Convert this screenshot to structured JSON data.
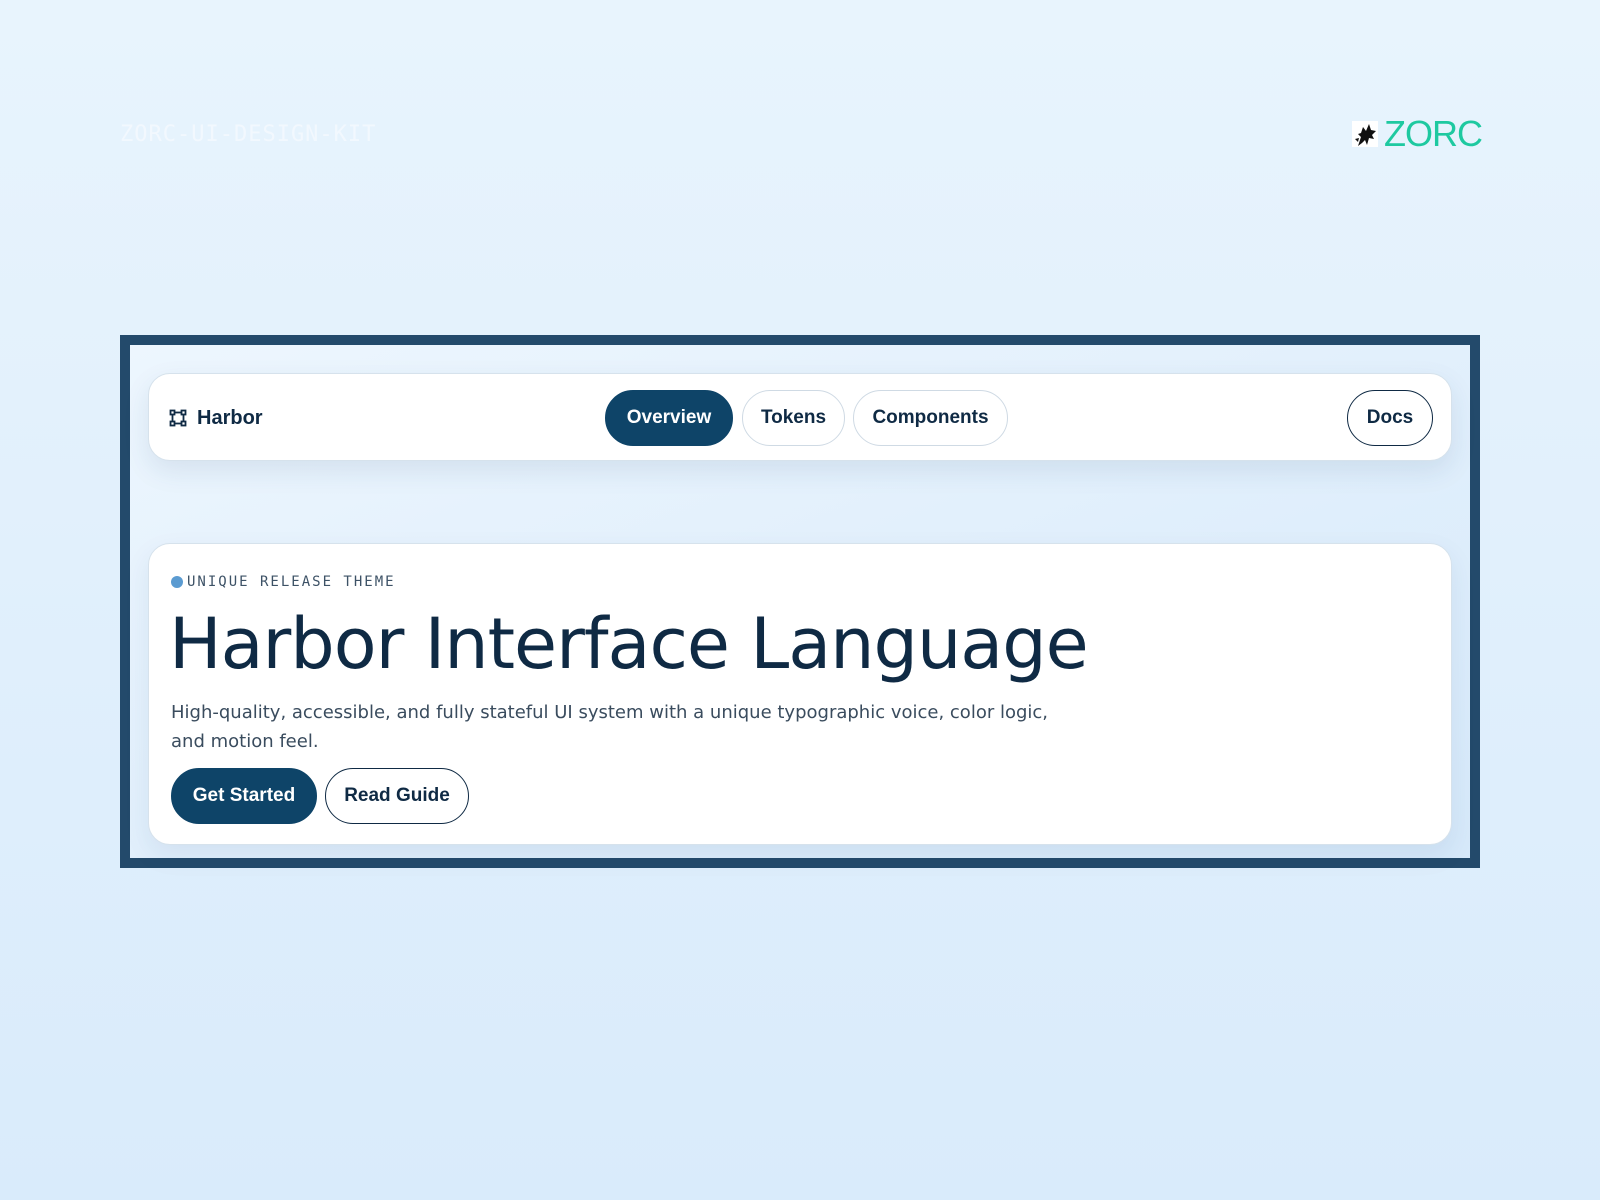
{
  "kit_label": "ZORC-UI-DESIGN-KIT",
  "brand": {
    "word": "ZORC",
    "mark_icon": "wolf-logo-icon",
    "color": "#1ec9a0"
  },
  "navbar": {
    "brand_label": "Harbor",
    "brand_icon": "vector-nodes-icon",
    "tabs": [
      {
        "label": "Overview",
        "active": true
      },
      {
        "label": "Tokens",
        "active": false
      },
      {
        "label": "Components",
        "active": false
      }
    ],
    "docs_label": "Docs"
  },
  "hero": {
    "eyebrow": "UNIQUE RELEASE THEME",
    "title": "Harbor Interface Language",
    "description": "High-quality, accessible, and fully stateful UI system with a unique typographic voice, color logic, and motion feel.",
    "primary_cta": "Get Started",
    "secondary_cta": "Read Guide"
  },
  "colors": {
    "primary": "#0e4468",
    "text": "#0f2a44",
    "frame_border": "#234a6b",
    "eyebrow_dot": "#5b9bd1"
  }
}
